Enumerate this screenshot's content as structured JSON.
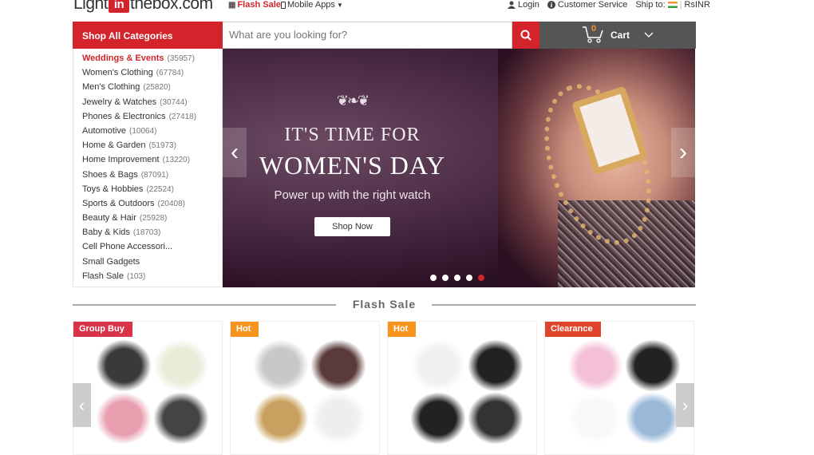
{
  "topbar": {
    "logo_left": "Light",
    "logo_mark": "in",
    "logo_right": "thebox.com",
    "flash_sale": "Flash Sale",
    "mobile_apps": "Mobile Apps",
    "login": "Login",
    "customer_service": "Customer Service",
    "ship_to": "Ship to:",
    "currency": "RsINR"
  },
  "header": {
    "shop_all": "Shop All Categories",
    "search_placeholder": "What are you looking for?",
    "cart_count": "0",
    "cart_label": "Cart"
  },
  "categories": [
    {
      "label": "Weddings & Events",
      "count": "(35957)",
      "active": true
    },
    {
      "label": "Women's Clothing",
      "count": "(67784)"
    },
    {
      "label": "Men's Clothing",
      "count": "(25820)"
    },
    {
      "label": "Jewelry & Watches",
      "count": "(30744)"
    },
    {
      "label": "Phones & Electronics",
      "count": "(27418)"
    },
    {
      "label": "Automotive",
      "count": "(10064)"
    },
    {
      "label": "Home & Garden",
      "count": "(51973)"
    },
    {
      "label": "Home Improvement",
      "count": "(13220)"
    },
    {
      "label": "Shoes & Bags",
      "count": "(87091)"
    },
    {
      "label": "Toys & Hobbies",
      "count": "(22524)"
    },
    {
      "label": "Sports & Outdoors",
      "count": "(20408)"
    },
    {
      "label": "Beauty & Hair",
      "count": "(25928)"
    },
    {
      "label": "Baby & Kids",
      "count": "(18703)"
    },
    {
      "label": "Cell Phone Accessori...",
      "count": ""
    },
    {
      "label": "Small Gadgets",
      "count": ""
    },
    {
      "label": "Flash Sale",
      "count": "(103)"
    }
  ],
  "banner": {
    "line1": "IT'S TIME FOR",
    "line2": "WOMEN'S DAY",
    "line3": "Power up with the right watch",
    "cta": "Shop Now",
    "slide_count": 5,
    "active_slide": 5
  },
  "flash_sale": {
    "title": "Flash Sale",
    "cards": [
      {
        "badge": "Group Buy",
        "badge_color": "#d9334a"
      },
      {
        "badge": "Hot",
        "badge_color": "#f7941d"
      },
      {
        "badge": "Hot",
        "badge_color": "#f7941d"
      },
      {
        "badge": "Clearance",
        "badge_color": "#e0452b"
      }
    ]
  },
  "colors": {
    "brand_red": "#d3242b",
    "cart_bg": "#555555",
    "cart_count": "#f39230"
  }
}
